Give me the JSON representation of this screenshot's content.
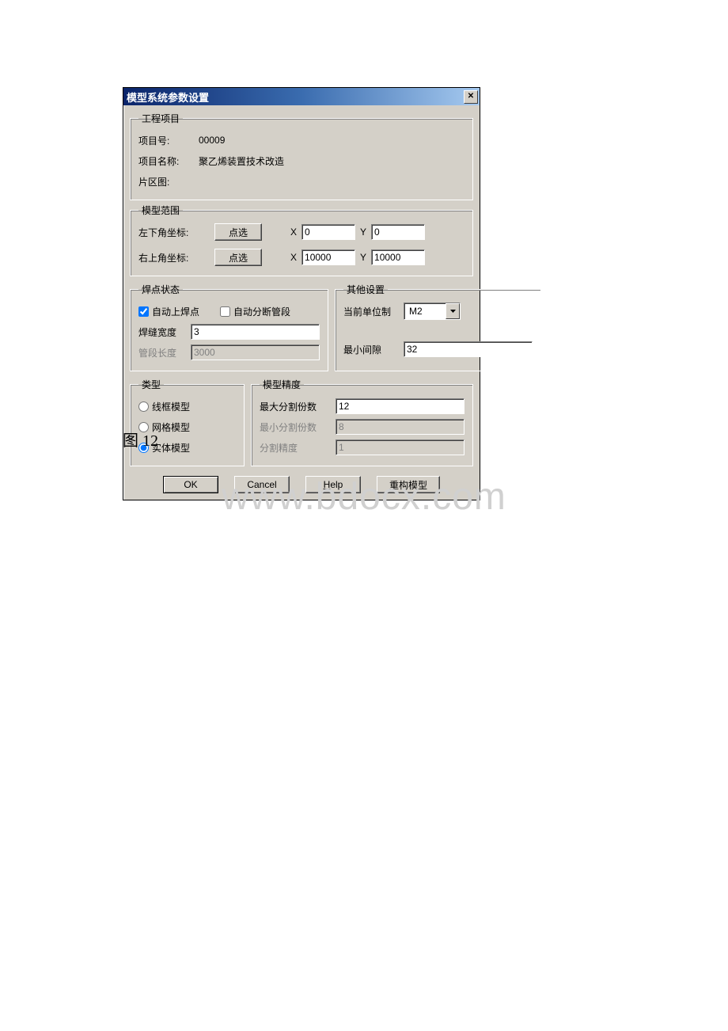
{
  "dialog": {
    "title": "模型系统参数设置"
  },
  "project": {
    "legend": "工程项目",
    "number_label": "项目号:",
    "number_value": "00009",
    "name_label": "项目名称:",
    "name_value": "聚乙烯装置技术改造",
    "zone_label": "片区图:"
  },
  "range": {
    "legend": "模型范围",
    "bl_label": "左下角坐标:",
    "tr_label": "右上角坐标:",
    "pick_btn": "点选",
    "x_label": "X",
    "y_label": "Y",
    "bl_x": "0",
    "bl_y": "0",
    "tr_x": "10000",
    "tr_y": "10000"
  },
  "weld": {
    "legend": "焊点状态",
    "auto_weld_label": "自动上焊点",
    "auto_break_label": "自动分断管段",
    "width_label": "焊缝宽度",
    "width_value": "3",
    "seg_len_label": "管段长度",
    "seg_len_value": "3000"
  },
  "other": {
    "legend": "其他设置",
    "unit_label": "当前单位制",
    "unit_value": "M2",
    "gap_label": "最小间隙",
    "gap_value": "32"
  },
  "type": {
    "legend": "类型",
    "wire_label": "线框模型",
    "mesh_label": "网格模型",
    "solid_label": "实体模型"
  },
  "precision": {
    "legend": "模型精度",
    "max_div_label": "最大分割份数",
    "max_div_value": "12",
    "min_div_label": "最小分割份数",
    "min_div_value": "8",
    "prec_label": "分割精度",
    "prec_value": "1"
  },
  "buttons": {
    "ok": "OK",
    "cancel": "Cancel",
    "help_prefix": "H",
    "help_rest": "elp",
    "rebuild": "重构模型"
  },
  "caption": "图 12",
  "watermark": "www.bdocx.com"
}
